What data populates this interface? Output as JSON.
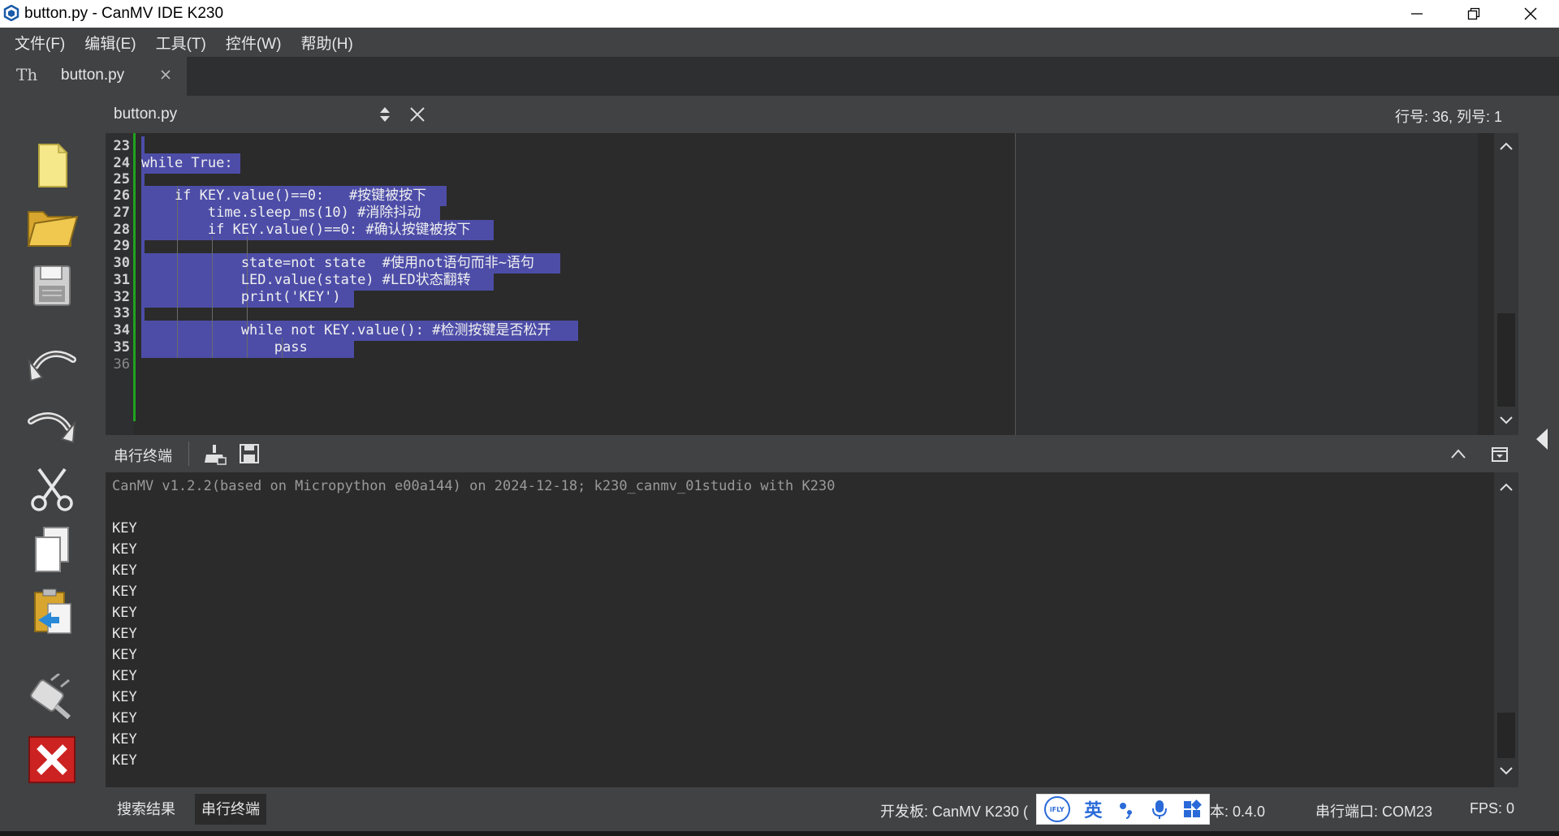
{
  "window": {
    "title": "button.py - CanMV IDE K230"
  },
  "menu": {
    "items": [
      {
        "label": "文件(F)"
      },
      {
        "label": "编辑(E)"
      },
      {
        "label": "工具(T)"
      },
      {
        "label": "控件(W)"
      },
      {
        "label": "帮助(H)"
      }
    ]
  },
  "tabs": {
    "active_label": "button.py",
    "glyph": "Th"
  },
  "editor": {
    "file_name": "button.py",
    "cursor_position": "行号: 36, 列号: 1",
    "line_numbers": [
      "23",
      "24",
      "25",
      "26",
      "27",
      "28",
      "29",
      "30",
      "31",
      "32",
      "33",
      "34",
      "35",
      "36"
    ],
    "lines": [
      "",
      "while True:",
      "",
      "    if KEY.value()==0:   #按键被按下",
      "        time.sleep_ms(10) #消除抖动",
      "        if KEY.value()==0: #确认按键被按下",
      "",
      "            state=not state  #使用not语句而非~语句",
      "            LED.value(state) #LED状态翻转",
      "            print('KEY')",
      "",
      "            while not KEY.value(): #检测按键是否松开",
      "                pass",
      ""
    ]
  },
  "terminal": {
    "title": "串行终端",
    "banner": "CanMV v1.2.2(based on Micropython e00a144) on 2024-12-18; k230_canmv_01studio with K230",
    "output": [
      "KEY",
      "KEY",
      "KEY",
      "KEY",
      "KEY",
      "KEY",
      "KEY",
      "KEY",
      "KEY",
      "KEY",
      "KEY",
      "KEY"
    ]
  },
  "statusbar": {
    "tab_search": "搜索结果",
    "tab_terminal": "串行终端",
    "board": "开发板: CanMV K230 (",
    "version": "本: 0.4.0",
    "serial_port": "串行端口: COM23",
    "fps": "FPS: 0"
  },
  "ime": {
    "logo_text": "iFLY",
    "lang": "英"
  },
  "toolbar": {
    "tools": [
      "new-file-icon",
      "open-folder-icon",
      "save-icon",
      "undo-icon",
      "redo-icon",
      "cut-icon",
      "copy-icon",
      "paste-icon",
      "connect-icon",
      "disconnect-icon"
    ]
  },
  "colors": {
    "selection": "#4d4da8",
    "background": "#2b2b2b",
    "panel": "#404244",
    "gutter_green": "#1fa31f",
    "disconnect_red": "#cc2222"
  }
}
